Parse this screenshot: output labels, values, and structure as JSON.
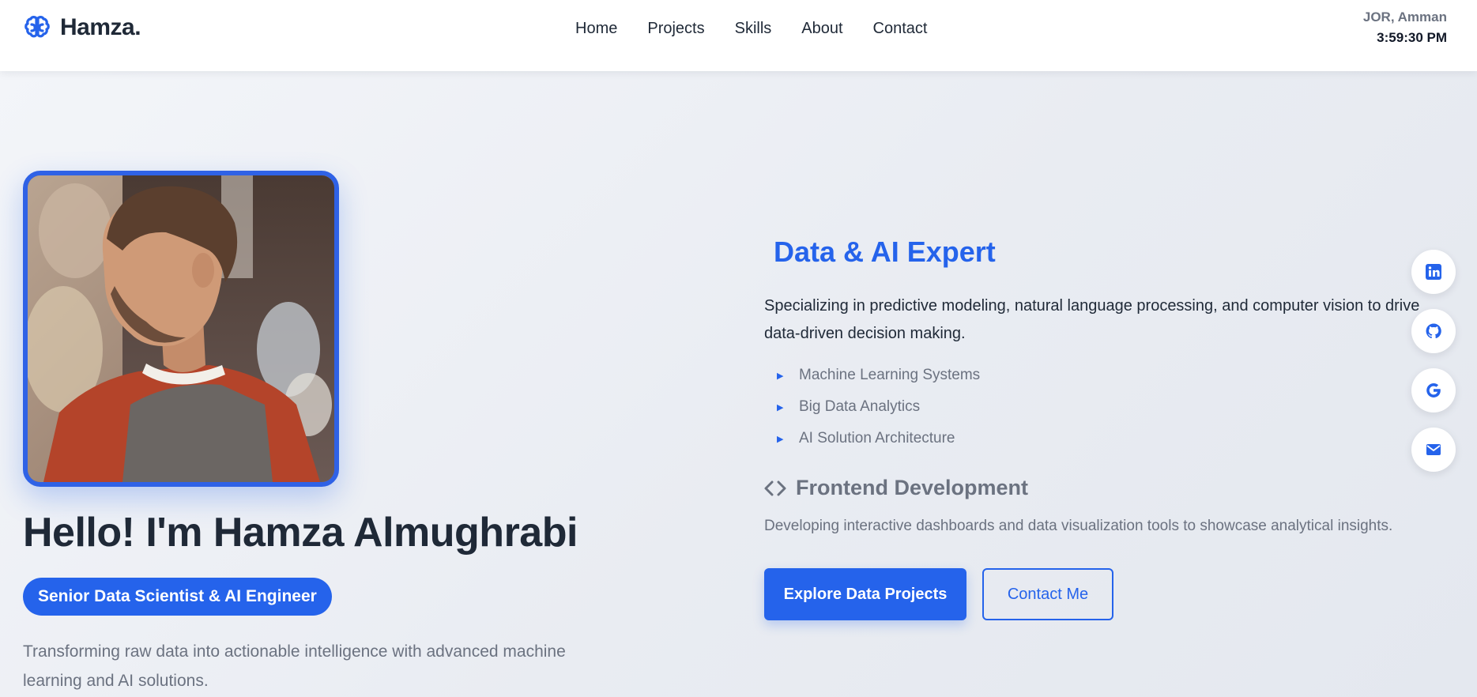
{
  "brand": {
    "name": "Hamza.",
    "icon": "brain-icon",
    "accent": "#2563eb"
  },
  "nav": {
    "items": [
      "Home",
      "Projects",
      "Skills",
      "About",
      "Contact"
    ]
  },
  "clock": {
    "location": "JOR, Amman",
    "time": "3:59:30 PM"
  },
  "hero": {
    "greeting": "Hello! I'm Hamza Almughrabi",
    "role": "Senior Data Scientist & AI Engineer",
    "tagline": "Transforming raw data into actionable intelligence with advanced machine learning and AI solutions."
  },
  "expertise": {
    "title": "Data & AI Expert",
    "description": "Specializing in predictive modeling, natural language processing, and computer vision to drive data-driven decision making.",
    "features": [
      "Machine Learning Systems",
      "Big Data Analytics",
      "AI Solution Architecture"
    ],
    "frontend_title": "Frontend Development",
    "frontend_icon": "code-icon",
    "frontend_description": "Developing interactive dashboards and data visualization tools to showcase analytical insights."
  },
  "buttons": {
    "primary": "Explore Data Projects",
    "secondary": "Contact Me"
  },
  "social": {
    "icons": [
      "linkedin-icon",
      "github-icon",
      "google-icon",
      "mail-icon"
    ]
  }
}
